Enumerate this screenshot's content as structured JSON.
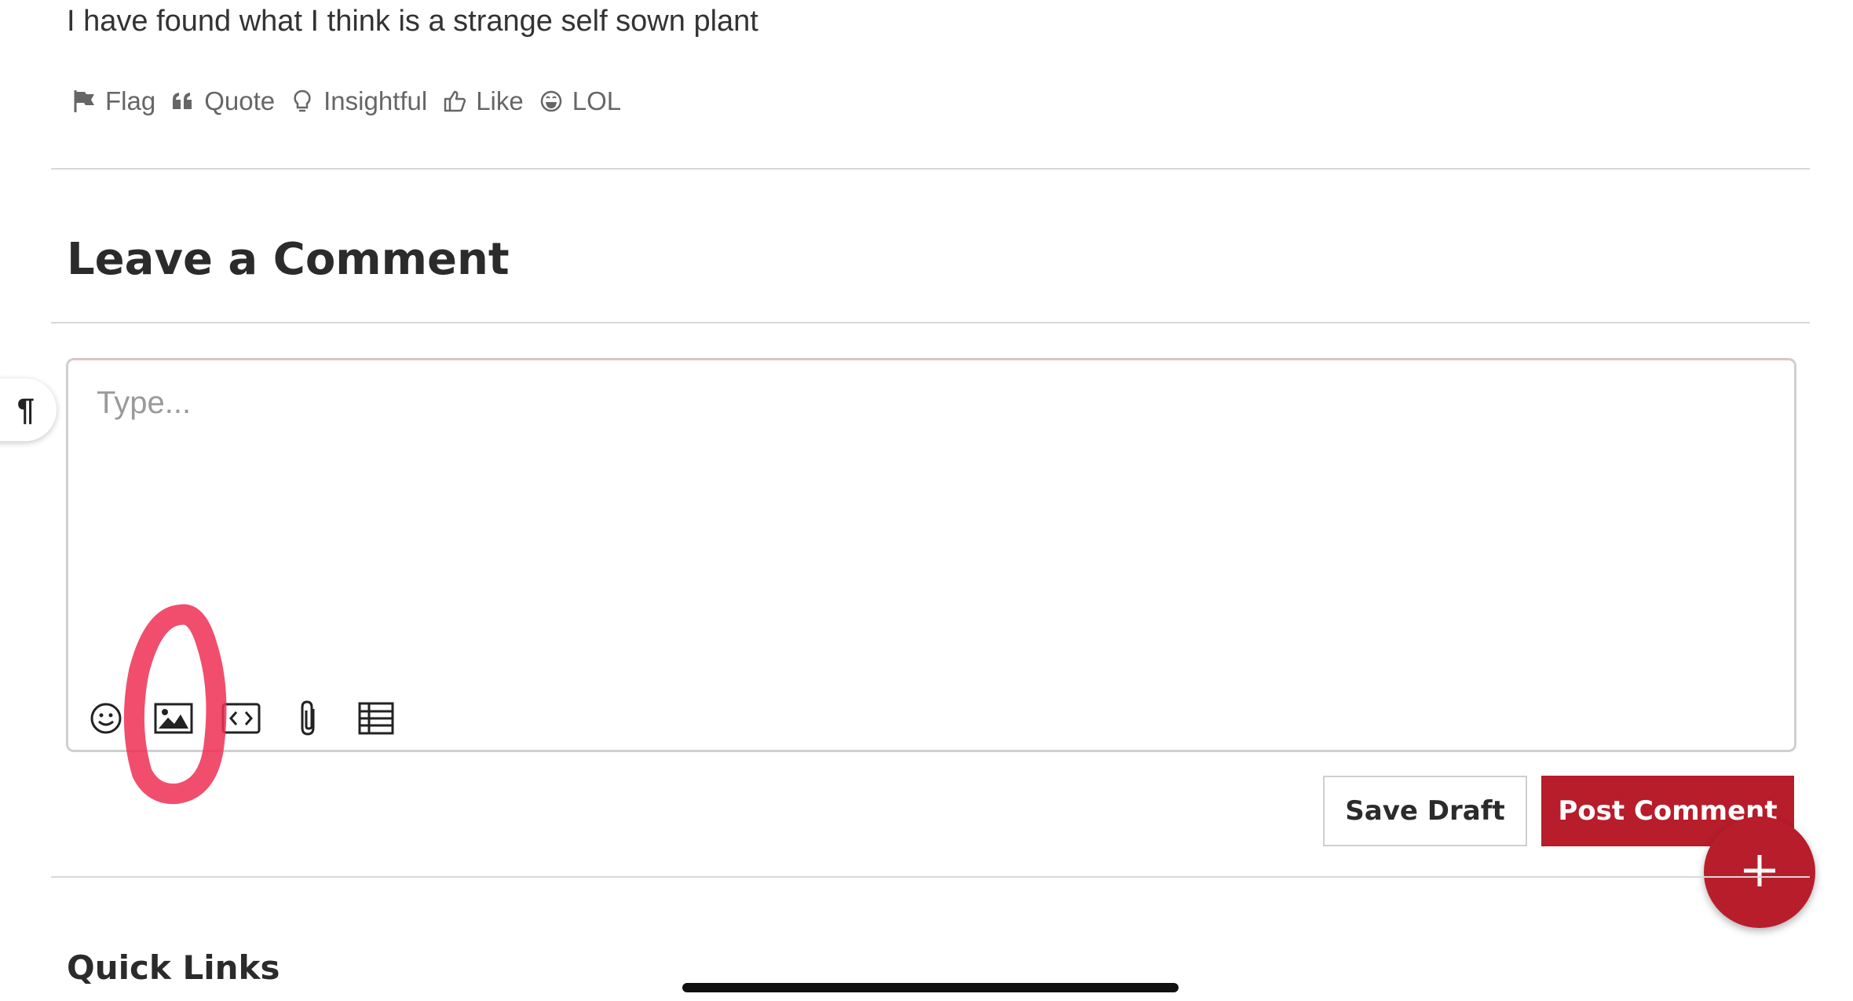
{
  "post": {
    "text": "I have found what I think is a strange self sown plant"
  },
  "reactions": [
    {
      "label": "Flag",
      "icon": "flag-icon"
    },
    {
      "label": "Quote",
      "icon": "quote-icon"
    },
    {
      "label": "Insightful",
      "icon": "lightbulb-icon"
    },
    {
      "label": "Like",
      "icon": "thumbs-up-icon"
    },
    {
      "label": "LOL",
      "icon": "laughing-face-icon"
    }
  ],
  "comment": {
    "heading": "Leave a Comment",
    "placeholder": "Type...",
    "paragraph_symbol": "¶",
    "toolbar": [
      "emoji-icon",
      "image-icon",
      "code-icon",
      "attachment-icon",
      "table-icon"
    ],
    "save_draft_label": "Save Draft",
    "post_label": "Post Comment"
  },
  "quick_links": {
    "heading": "Quick Links"
  },
  "colors": {
    "accent": "#b81d2b",
    "annotation": "#ee2f54"
  }
}
